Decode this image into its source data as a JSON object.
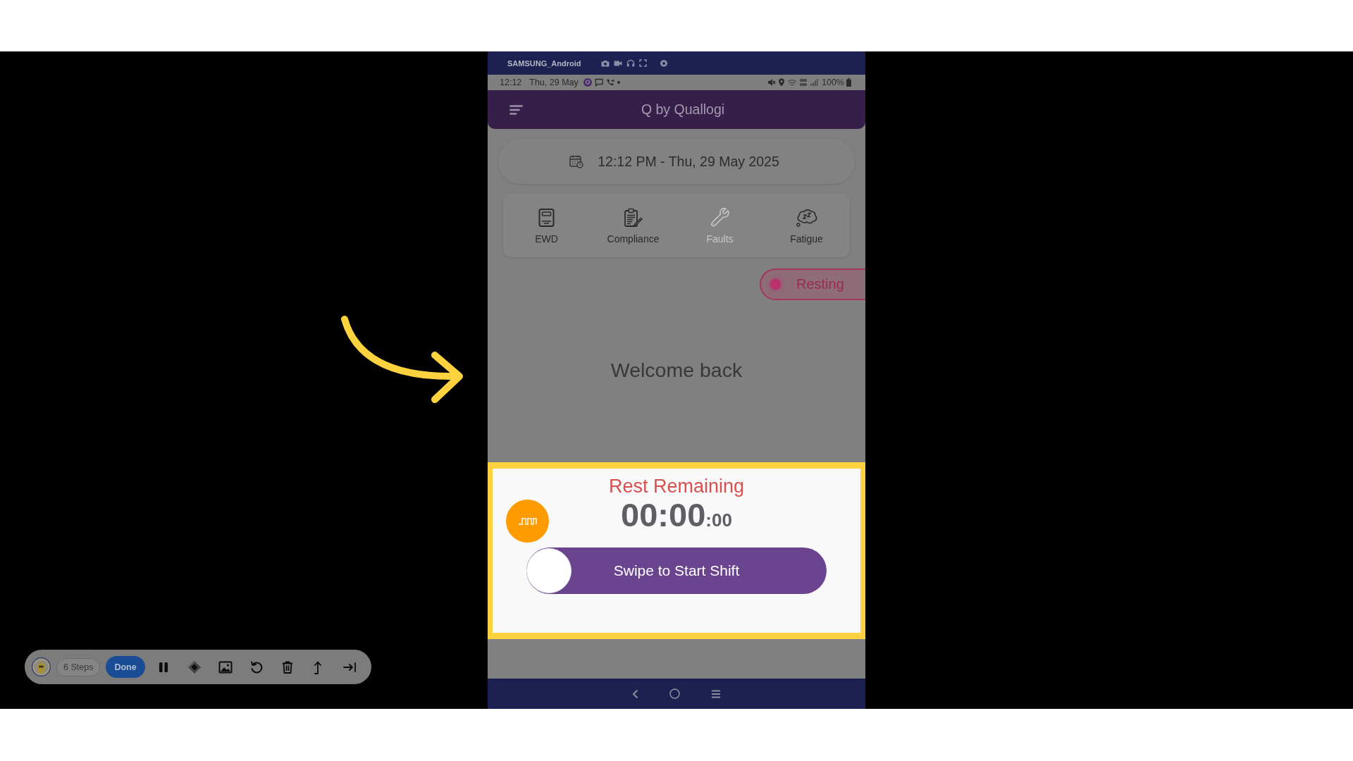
{
  "device_bar": {
    "title": "SAMSUNG_Android"
  },
  "status_bar": {
    "time": "12:12",
    "date": "Thu, 29 May",
    "battery": "100%"
  },
  "app_bar": {
    "title": "Q by Quallogi"
  },
  "datetime": "12:12 PM - Thu, 29 May 2025",
  "shortcuts": [
    {
      "label": "EWD",
      "disabled": false
    },
    {
      "label": "Compliance",
      "disabled": false
    },
    {
      "label": "Faults",
      "disabled": true
    },
    {
      "label": "Fatigue",
      "disabled": false
    }
  ],
  "status_chip": {
    "label": "Resting",
    "color": "#b9306c"
  },
  "welcome": "Welcome back",
  "rest_panel": {
    "highlighted": true,
    "title": "Rest Remaining",
    "timer": {
      "main": "00:00",
      "seconds": ":00"
    },
    "swipe": {
      "label": "Swipe to Start Shift",
      "level": 0
    }
  },
  "recorder_toolbar": {
    "steps": "6 Steps",
    "done": "Done"
  }
}
